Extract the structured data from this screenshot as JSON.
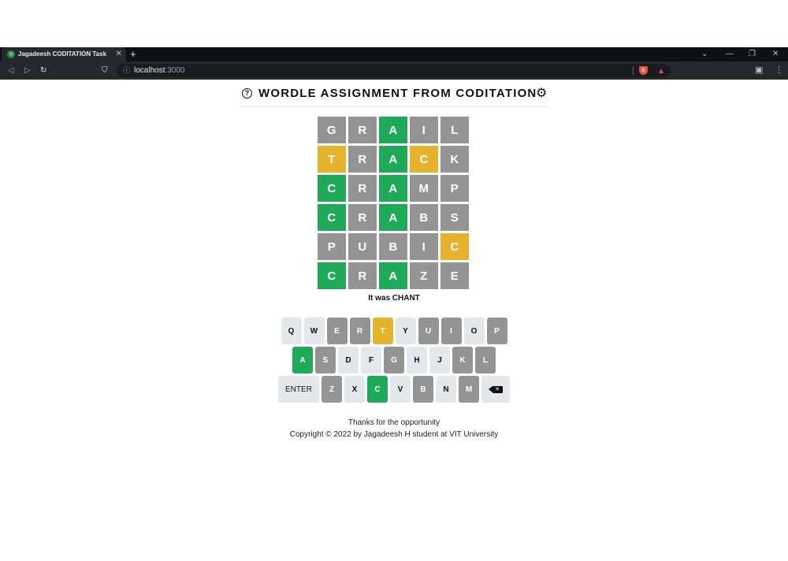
{
  "browser": {
    "tab_title": "Jagadeesh CODITATION Task",
    "tab_close": "✕",
    "new_tab": "+",
    "url_host": "localhost",
    "url_port": ":3000"
  },
  "header": {
    "title": "WORDLE ASSIGNMENT FROM CODITATION"
  },
  "board": {
    "rows": [
      [
        {
          "l": "G",
          "s": "absent"
        },
        {
          "l": "R",
          "s": "absent"
        },
        {
          "l": "A",
          "s": "correct"
        },
        {
          "l": "I",
          "s": "absent"
        },
        {
          "l": "L",
          "s": "absent"
        }
      ],
      [
        {
          "l": "T",
          "s": "present"
        },
        {
          "l": "R",
          "s": "absent"
        },
        {
          "l": "A",
          "s": "correct"
        },
        {
          "l": "C",
          "s": "present"
        },
        {
          "l": "K",
          "s": "absent"
        }
      ],
      [
        {
          "l": "C",
          "s": "correct"
        },
        {
          "l": "R",
          "s": "absent"
        },
        {
          "l": "A",
          "s": "correct"
        },
        {
          "l": "M",
          "s": "absent"
        },
        {
          "l": "P",
          "s": "absent"
        }
      ],
      [
        {
          "l": "C",
          "s": "correct"
        },
        {
          "l": "R",
          "s": "absent"
        },
        {
          "l": "A",
          "s": "correct"
        },
        {
          "l": "B",
          "s": "absent"
        },
        {
          "l": "S",
          "s": "absent"
        }
      ],
      [
        {
          "l": "P",
          "s": "absent"
        },
        {
          "l": "U",
          "s": "absent"
        },
        {
          "l": "B",
          "s": "absent"
        },
        {
          "l": "I",
          "s": "absent"
        },
        {
          "l": "C",
          "s": "present"
        }
      ],
      [
        {
          "l": "C",
          "s": "correct"
        },
        {
          "l": "R",
          "s": "absent"
        },
        {
          "l": "A",
          "s": "correct"
        },
        {
          "l": "Z",
          "s": "absent"
        },
        {
          "l": "E",
          "s": "absent"
        }
      ]
    ]
  },
  "answer_text": "It was CHANT",
  "keyboard": {
    "rows": [
      [
        {
          "k": "Q",
          "s": ""
        },
        {
          "k": "W",
          "s": ""
        },
        {
          "k": "E",
          "s": "absent"
        },
        {
          "k": "R",
          "s": "absent"
        },
        {
          "k": "T",
          "s": "present"
        },
        {
          "k": "Y",
          "s": ""
        },
        {
          "k": "U",
          "s": "absent"
        },
        {
          "k": "I",
          "s": "absent"
        },
        {
          "k": "O",
          "s": ""
        },
        {
          "k": "P",
          "s": "absent"
        }
      ],
      [
        {
          "k": "A",
          "s": "correct"
        },
        {
          "k": "S",
          "s": "absent"
        },
        {
          "k": "D",
          "s": ""
        },
        {
          "k": "F",
          "s": ""
        },
        {
          "k": "G",
          "s": "absent"
        },
        {
          "k": "H",
          "s": ""
        },
        {
          "k": "J",
          "s": ""
        },
        {
          "k": "K",
          "s": "absent"
        },
        {
          "k": "L",
          "s": "absent"
        }
      ],
      [
        {
          "k": "ENTER",
          "s": "",
          "wide": true
        },
        {
          "k": "Z",
          "s": "absent"
        },
        {
          "k": "X",
          "s": ""
        },
        {
          "k": "C",
          "s": "correct"
        },
        {
          "k": "V",
          "s": ""
        },
        {
          "k": "B",
          "s": "absent"
        },
        {
          "k": "N",
          "s": ""
        },
        {
          "k": "M",
          "s": "absent"
        },
        {
          "k": "",
          "s": "",
          "backspace": true
        }
      ]
    ]
  },
  "footer": {
    "line1": "Thanks for the opportunity",
    "line2": "Copyright © 2022 by Jagadeesh H student at VIT University"
  }
}
